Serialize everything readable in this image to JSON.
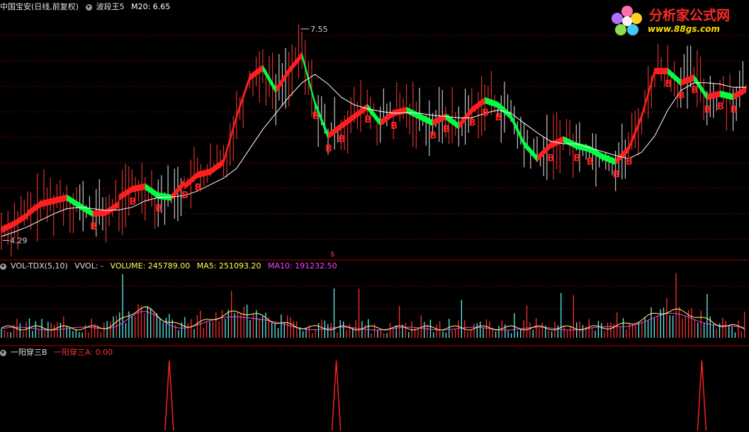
{
  "main_header": {
    "symbol": "中国宝安(日线,前复权)",
    "indicator": "波段王5",
    "ma20_label": "M20: 6.65"
  },
  "price_labels": {
    "high": "7.55",
    "low": "4.29"
  },
  "volume_header": {
    "name": "VOL-TDX(5,10)",
    "vvol": "VVOL: -",
    "volume": "VOLUME: 245789.00",
    "ma5": "MA5: 251093.20",
    "ma10": "MA10: 191232.50"
  },
  "signal_header": {
    "name": "一阳穿三B",
    "value": "一阳穿三A: 0.00"
  },
  "logo": {
    "name": "分析家公式网",
    "url": "www.88gs.com"
  },
  "colors": {
    "up": "#ff1e1e",
    "down": "#00ff40",
    "ma": "#ffffff",
    "vol_up": "#ff3030",
    "vol_down": "#60f0f0",
    "ma5": "#ffff60",
    "ma10": "#ff40ff",
    "grid": "#7a0000",
    "signal": "#ff2020"
  },
  "chart_data": [
    {
      "type": "line",
      "title": "波段王5",
      "ylim": [
        4.0,
        7.8
      ],
      "band_close": [
        4.45,
        4.55,
        4.68,
        4.85,
        4.9,
        4.95,
        4.82,
        4.7,
        4.72,
        4.85,
        5.08,
        5.12,
        4.98,
        4.95,
        5.18,
        5.3,
        5.35,
        5.5,
        6.2,
        6.8,
        6.95,
        6.6,
        6.9,
        7.15,
        6.4,
        5.9,
        6.05,
        6.2,
        6.35,
        6.1,
        6.25,
        6.3,
        6.2,
        6.1,
        6.2,
        6.05,
        6.3,
        6.45,
        6.38,
        6.2,
        5.78,
        5.55,
        5.75,
        5.85,
        5.75,
        5.7,
        5.58,
        5.5,
        5.7,
        6.2,
        6.9,
        6.9,
        6.72,
        6.8,
        6.5,
        6.55,
        6.5,
        6.62
      ],
      "band_open": [
        4.35,
        4.45,
        4.55,
        4.7,
        4.85,
        4.9,
        4.95,
        4.82,
        4.7,
        4.72,
        4.95,
        5.08,
        5.12,
        4.98,
        4.95,
        5.12,
        5.3,
        5.35,
        5.5,
        6.2,
        6.8,
        6.95,
        6.6,
        6.9,
        7.15,
        6.4,
        5.9,
        6.05,
        6.2,
        6.35,
        6.1,
        6.25,
        6.3,
        6.2,
        6.1,
        6.2,
        6.05,
        6.3,
        6.45,
        6.38,
        6.2,
        5.78,
        5.55,
        5.75,
        5.85,
        5.75,
        5.7,
        5.58,
        5.5,
        5.7,
        6.2,
        6.9,
        6.9,
        6.72,
        6.8,
        6.5,
        6.55,
        6.5
      ],
      "ma_line": [
        4.35,
        4.42,
        4.5,
        4.6,
        4.7,
        4.78,
        4.8,
        4.78,
        4.75,
        4.76,
        4.8,
        4.9,
        4.95,
        4.96,
        4.98,
        5.05,
        5.15,
        5.25,
        5.4,
        5.7,
        6.0,
        6.25,
        6.5,
        6.72,
        6.85,
        6.7,
        6.5,
        6.38,
        6.32,
        6.28,
        6.25,
        6.26,
        6.25,
        6.22,
        6.2,
        6.18,
        6.18,
        6.25,
        6.3,
        6.25,
        6.1,
        5.95,
        5.82,
        5.78,
        5.78,
        5.72,
        5.66,
        5.6,
        5.55,
        5.65,
        5.9,
        6.3,
        6.6,
        6.72,
        6.72,
        6.7,
        6.65,
        6.65
      ],
      "buy_marks": [
        7,
        10,
        12,
        14,
        15,
        24,
        25,
        26,
        28,
        30,
        33,
        34,
        36,
        37,
        38,
        42,
        44,
        45,
        47,
        48,
        51,
        52,
        53,
        54,
        55,
        56
      ]
    },
    {
      "type": "bar",
      "title": "VOL-TDX(5,10)",
      "series": [
        {
          "name": "VOLUME",
          "last": 245789.0
        },
        {
          "name": "MA5",
          "last": 251093.2
        },
        {
          "name": "MA10",
          "last": 191232.5
        }
      ]
    },
    {
      "type": "line",
      "title": "一阳穿三B",
      "spike_positions": [
        0.226,
        0.449,
        0.937
      ],
      "value": 0.0
    }
  ]
}
